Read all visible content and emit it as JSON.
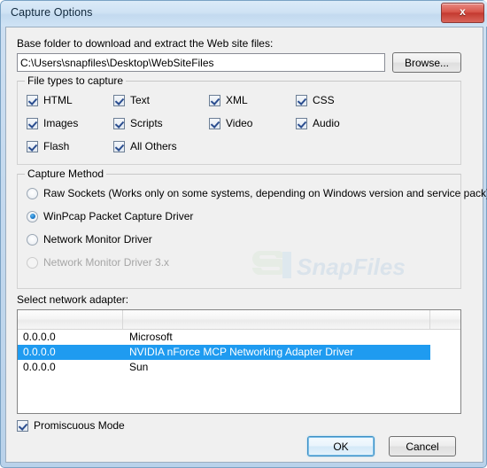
{
  "window": {
    "title": "Capture Options",
    "close_label": "x"
  },
  "path_section": {
    "label": "Base folder to download and extract the Web site files:",
    "value": "C:\\Users\\snapfiles\\Desktop\\WebSiteFiles",
    "placeholder": "",
    "browse_label": "Browse..."
  },
  "file_types": {
    "title": "File types to capture",
    "items": [
      {
        "label": "HTML",
        "checked": true
      },
      {
        "label": "Text",
        "checked": true
      },
      {
        "label": "XML",
        "checked": true
      },
      {
        "label": "CSS",
        "checked": true
      },
      {
        "label": "Images",
        "checked": true
      },
      {
        "label": "Scripts",
        "checked": true
      },
      {
        "label": "Video",
        "checked": true
      },
      {
        "label": "Audio",
        "checked": true
      },
      {
        "label": "Flash",
        "checked": true
      },
      {
        "label": "All Others",
        "checked": true
      }
    ]
  },
  "capture_method": {
    "title": "Capture Method",
    "options": [
      {
        "label": "Raw Sockets  (Works only on some systems, depending on Windows version and service pack)",
        "selected": false,
        "disabled": false
      },
      {
        "label": "WinPcap Packet Capture Driver",
        "selected": true,
        "disabled": false
      },
      {
        "label": "Network Monitor Driver",
        "selected": false,
        "disabled": false
      },
      {
        "label": "Network Monitor Driver 3.x",
        "selected": false,
        "disabled": true
      }
    ]
  },
  "watermark": {
    "text": "SnapFiles"
  },
  "adapters": {
    "label": "Select network adapter:",
    "columns": [
      "",
      "",
      ""
    ],
    "rows": [
      {
        "ip": "0.0.0.0",
        "name": "Microsoft",
        "selected": false
      },
      {
        "ip": "0.0.0.0",
        "name": "NVIDIA nForce MCP Networking Adapter Driver",
        "selected": true
      },
      {
        "ip": "0.0.0.0",
        "name": "Sun",
        "selected": false
      }
    ]
  },
  "promiscuous": {
    "label": "Promiscuous Mode",
    "checked": true
  },
  "buttons": {
    "ok": "OK",
    "cancel": "Cancel"
  },
  "colors": {
    "selection": "#1f9bf0",
    "titlebar": "#cfe2f4",
    "close_button": "#c43a30",
    "dialog_face": "#f0f0f0"
  }
}
